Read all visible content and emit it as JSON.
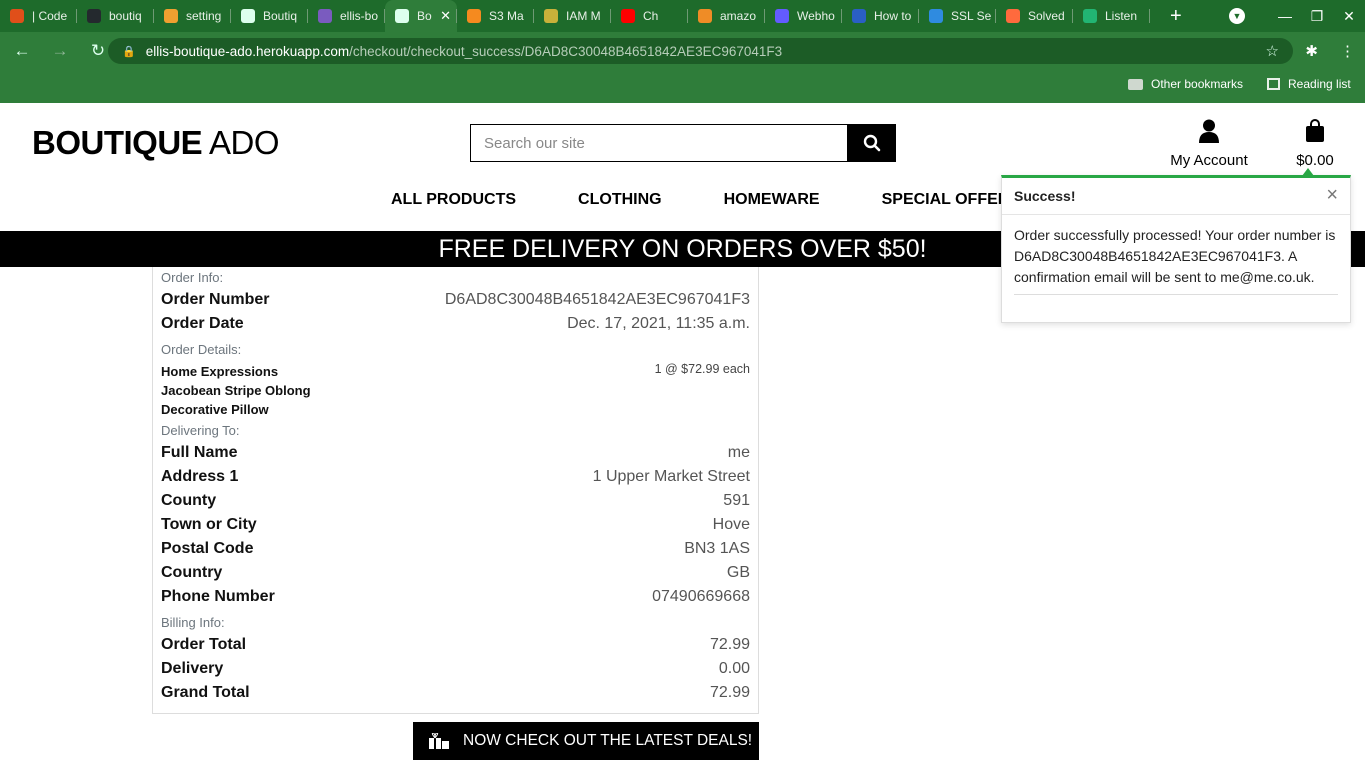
{
  "browser": {
    "tabs": [
      {
        "title": "| Code",
        "color": "#e04f1a"
      },
      {
        "title": "boutiq",
        "color": "#24292e"
      },
      {
        "title": "setting",
        "color": "#f0a030"
      },
      {
        "title": "Boutiq",
        "color": "#dfe"
      },
      {
        "title": "ellis-bo",
        "color": "#7a5bbf"
      },
      {
        "title": "Bo",
        "color": "#dfe"
      },
      {
        "title": "S3 Ma",
        "color": "#f58a1f"
      },
      {
        "title": "IAM M",
        "color": "#c9b13a"
      },
      {
        "title": "Ch",
        "color": "#ff0000"
      },
      {
        "title": "amazo",
        "color": "#ef8c26"
      },
      {
        "title": "Webho",
        "color": "#635bff"
      },
      {
        "title": "How to",
        "color": "#2a5fc4"
      },
      {
        "title": "SSL Se",
        "color": "#2f8be0"
      },
      {
        "title": "Solved",
        "color": "#ff6a3d"
      },
      {
        "title": "Listen",
        "color": "#22b573"
      }
    ],
    "url_host": "ellis-boutique-ado.herokuapp.com",
    "url_path": "/checkout/checkout_success/D6AD8C30048B4651842AE3EC967041F3",
    "bookmarks": {
      "other": "Other bookmarks",
      "reading_list": "Reading list"
    }
  },
  "site": {
    "logo_bold": "BOUTIQUE",
    "logo_light": " ADO",
    "search_placeholder": "Search our site",
    "account_label": "My Account",
    "cart_total": "$0.00",
    "nav": [
      "ALL PRODUCTS",
      "CLOTHING",
      "HOMEWARE",
      "SPECIAL OFFERS"
    ],
    "banner": "FREE DELIVERY ON ORDERS OVER $50!"
  },
  "order": {
    "order_info_label": "Order Info:",
    "order_number_label": "Order Number",
    "order_number": "D6AD8C30048B4651842AE3EC967041F3",
    "order_date_label": "Order Date",
    "order_date": "Dec. 17, 2021, 11:35 a.m.",
    "order_details_label": "Order Details:",
    "item_name": "Home Expressions Jacobean Stripe Oblong Decorative Pillow",
    "item_qty": "1 @ $72.99 each",
    "delivering_label": "Delivering To:",
    "delivery": [
      {
        "label": "Full Name",
        "value": "me"
      },
      {
        "label": "Address 1",
        "value": "1 Upper Market Street"
      },
      {
        "label": "County",
        "value": "591"
      },
      {
        "label": "Town or City",
        "value": "Hove"
      },
      {
        "label": "Postal Code",
        "value": "BN3 1AS"
      },
      {
        "label": "Country",
        "value": "GB"
      },
      {
        "label": "Phone Number",
        "value": "07490669668"
      }
    ],
    "billing_label": "Billing Info:",
    "billing": [
      {
        "label": "Order Total",
        "value": "72.99"
      },
      {
        "label": "Delivery",
        "value": "0.00"
      },
      {
        "label": "Grand Total",
        "value": "72.99"
      }
    ],
    "deals_button": "NOW CHECK OUT THE LATEST DEALS!"
  },
  "toast": {
    "title": "Success!",
    "message": "Order successfully processed! Your order number is D6AD8C30048B4651842AE3EC967041F3. A confirmation email will be sent to me@me.co.uk.",
    "accent": "#28a745"
  }
}
